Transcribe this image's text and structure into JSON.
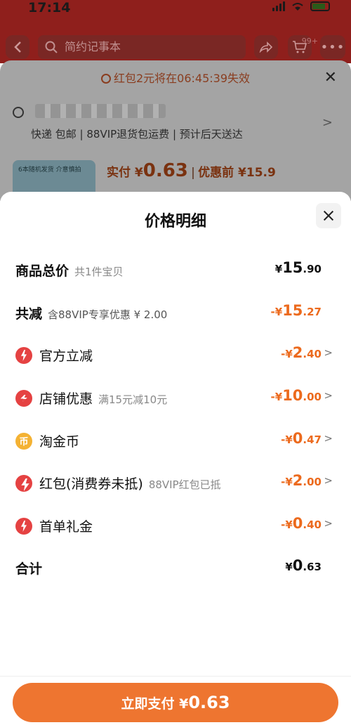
{
  "status_bar": {
    "time": "17:14"
  },
  "top_bar": {
    "search_text": "简约记事本",
    "cart_badge": "99+"
  },
  "background": {
    "countdown": "红包2元将在06:45:39失效",
    "shipping": "快递 包邮 | 88VIP退货包运费 | 预计后天送达",
    "thumb_text": "6本随机发货 介意慎拍",
    "paid_label": "实付 ¥",
    "paid_amount": "0.63",
    "before_label": "优惠前 ¥15.9"
  },
  "sheet": {
    "title": "价格明细",
    "rows": [
      {
        "label": "商品总价",
        "sub": "共1件宝贝",
        "prefix": "¥",
        "int": "15",
        "dec": ".90"
      },
      {
        "label": "共减",
        "sub": "含88VIP专享优惠 ¥ 2.00",
        "prefix": "-¥",
        "int": "15",
        "dec": ".27"
      },
      {
        "label": "官方立减",
        "sub": "",
        "prefix": "-¥",
        "int": "2",
        "dec": ".40",
        "icon": "lightning-icon"
      },
      {
        "label": "店铺优惠",
        "sub": "满15元减10元",
        "prefix": "-¥",
        "int": "10",
        "dec": ".00",
        "icon": "store-icon"
      },
      {
        "label": "淘金币",
        "sub": "",
        "prefix": "-¥",
        "int": "0",
        "dec": ".47",
        "icon": "coin-icon"
      },
      {
        "label": "红包(消费券未抵)",
        "sub": "88VIP红包已抵",
        "prefix": "-¥",
        "int": "2",
        "dec": ".00",
        "icon": "red-envelope-icon"
      },
      {
        "label": "首单礼金",
        "sub": "",
        "prefix": "-¥",
        "int": "0",
        "dec": ".40",
        "icon": "lightning-icon"
      },
      {
        "label": "合计",
        "sub": "",
        "prefix": "¥",
        "int": "0",
        "dec": ".63"
      }
    ],
    "arrow": ">"
  },
  "footer": {
    "pay_label": "立即支付 ¥",
    "pay_amount": "0.63"
  },
  "colors": {
    "accent": "#ec6a1d",
    "button": "#ee7530",
    "icon_red": "#e54242",
    "coin": "#f4b233"
  }
}
